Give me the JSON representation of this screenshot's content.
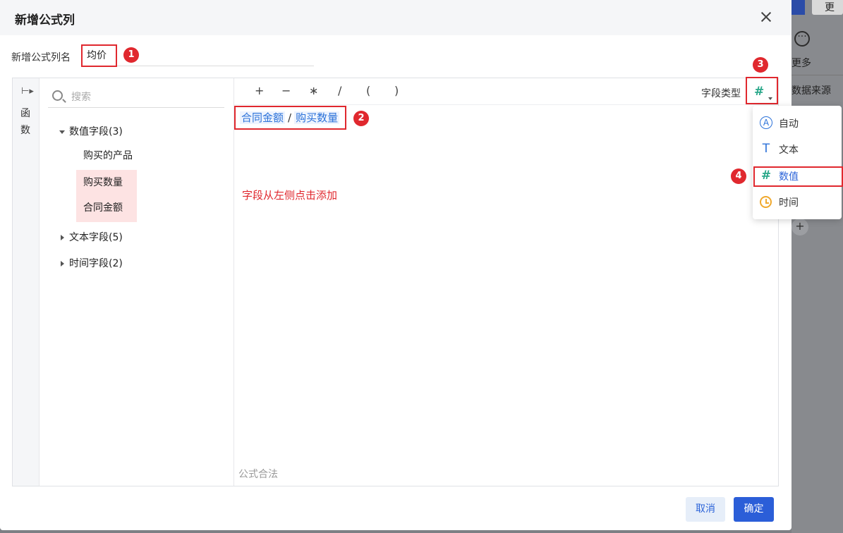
{
  "background": {
    "button_label": "更",
    "more_label": "更多",
    "source_label": "数据来源",
    "plus_label": "+"
  },
  "dialog": {
    "title": "新增公式列",
    "name_label": "新增公式列名",
    "name_value": "均价",
    "func_tab_label": "函数",
    "search_placeholder": "搜索",
    "tree": {
      "groups": [
        {
          "label": "数值字段(3)",
          "expanded": true
        },
        {
          "label": "文本字段(5)",
          "expanded": false
        },
        {
          "label": "时间字段(2)",
          "expanded": false
        }
      ],
      "numeric_items": [
        "购买的产品",
        "购买数量",
        "合同金额"
      ]
    },
    "operators": [
      "+",
      "−",
      "∗",
      "/",
      "(",
      ")"
    ],
    "field_type_label": "字段类型",
    "field_type_icon": "hash-icon",
    "formula": {
      "left_field": "合同金额",
      "operator": "/",
      "right_field": "购买数量"
    },
    "hint": "字段从左侧点击添加",
    "validation": "公式合法",
    "type_options": [
      {
        "label": "自动",
        "icon": "auto-icon"
      },
      {
        "label": "文本",
        "icon": "text-icon"
      },
      {
        "label": "数值",
        "icon": "hash-icon",
        "selected": true
      },
      {
        "label": "时间",
        "icon": "clock-icon"
      }
    ],
    "cancel_label": "取消",
    "ok_label": "确定"
  },
  "annotations": [
    "1",
    "2",
    "3",
    "4"
  ],
  "colors": {
    "primary": "#2b5ed8",
    "annotation_red": "#e0282e",
    "numeric_green": "#2aa88a",
    "highlight_pink": "#fde3e3"
  }
}
